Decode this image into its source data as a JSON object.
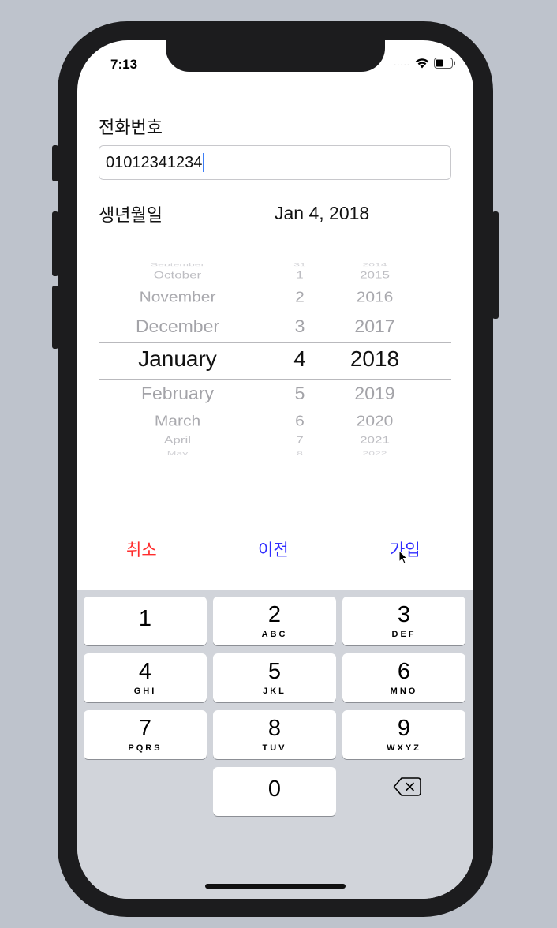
{
  "status_bar": {
    "time": "7:13",
    "signal": "....."
  },
  "form": {
    "phone_label": "전화번호",
    "phone_value": "01012341234",
    "birth_label": "생년월일",
    "birth_value": "Jan 4, 2018"
  },
  "picker": {
    "months": [
      "September",
      "October",
      "November",
      "December",
      "January",
      "February",
      "March",
      "April",
      "May"
    ],
    "days": [
      "31",
      "1",
      "2",
      "3",
      "4",
      "5",
      "6",
      "7",
      "8"
    ],
    "years": [
      "2014",
      "2015",
      "2016",
      "2017",
      "2018",
      "2019",
      "2020",
      "2021",
      "2022"
    ],
    "selected": {
      "month": "January",
      "day": "4",
      "year": "2018"
    }
  },
  "actions": {
    "cancel_label": "취소",
    "prev_label": "이전",
    "join_label": "가입"
  },
  "colors": {
    "cancel": "#ff2d2d",
    "prev": "#2f2cff",
    "join": "#2f2cff"
  },
  "keypad": {
    "keys": [
      {
        "digit": "1",
        "letters": ""
      },
      {
        "digit": "2",
        "letters": "ABC"
      },
      {
        "digit": "3",
        "letters": "DEF"
      },
      {
        "digit": "4",
        "letters": "GHI"
      },
      {
        "digit": "5",
        "letters": "JKL"
      },
      {
        "digit": "6",
        "letters": "MNO"
      },
      {
        "digit": "7",
        "letters": "PQRS"
      },
      {
        "digit": "8",
        "letters": "TUV"
      },
      {
        "digit": "9",
        "letters": "WXYZ"
      },
      {
        "digit": "0",
        "letters": ""
      }
    ],
    "delete_icon": "backspace-icon"
  }
}
